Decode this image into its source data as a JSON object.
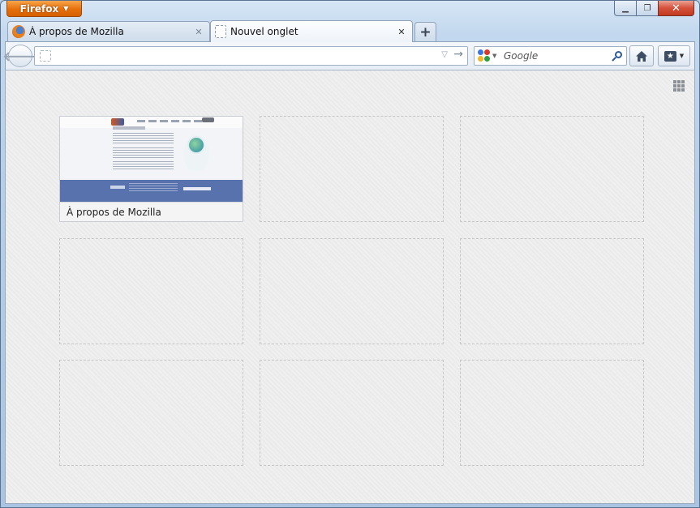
{
  "app_button": {
    "label": "Firefox"
  },
  "tabs": [
    {
      "label": "À propos de Mozilla",
      "icon": "firefox-icon",
      "active": false
    },
    {
      "label": "Nouvel onglet",
      "icon": "blank-page-icon",
      "active": true
    }
  ],
  "newtab": {
    "label": "+"
  },
  "navbar": {
    "url_value": "",
    "search_placeholder": "Google",
    "search_engine": "Google"
  },
  "newtab_page": {
    "tiles": [
      {
        "title": "À propos de Mozilla",
        "filled": true
      },
      {
        "title": "",
        "filled": false
      },
      {
        "title": "",
        "filled": false
      },
      {
        "title": "",
        "filled": false
      },
      {
        "title": "",
        "filled": false
      },
      {
        "title": "",
        "filled": false
      },
      {
        "title": "",
        "filled": false
      },
      {
        "title": "",
        "filled": false
      },
      {
        "title": "",
        "filled": false
      }
    ]
  },
  "colors": {
    "app_button": "#e66f0b",
    "close_button": "#c23a20",
    "content_bg": "#ededed"
  }
}
